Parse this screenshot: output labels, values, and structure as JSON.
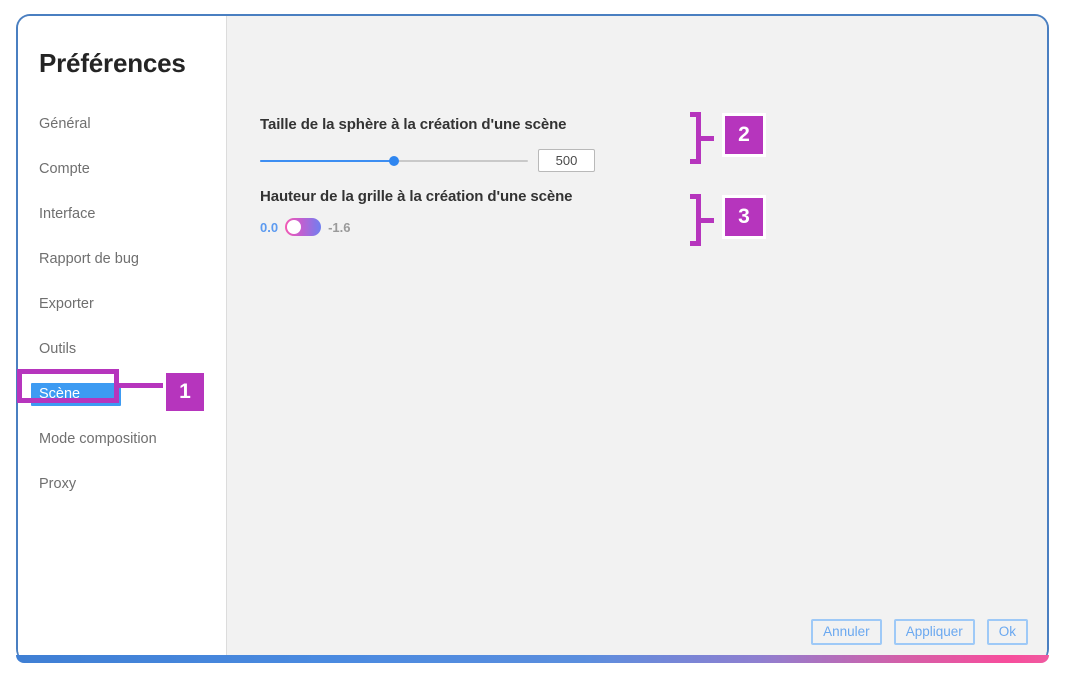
{
  "window": {
    "title": "Préférences",
    "border_color": "#4a7fc1",
    "bottom_gradient_from": "#3f7fd4",
    "bottom_gradient_to": "#f74d9c"
  },
  "sidebar": {
    "items": [
      {
        "label": "Général",
        "selected": false
      },
      {
        "label": "Compte",
        "selected": false
      },
      {
        "label": "Interface",
        "selected": false
      },
      {
        "label": "Rapport de bug",
        "selected": false
      },
      {
        "label": "Exporter",
        "selected": false
      },
      {
        "label": "Outils",
        "selected": false
      },
      {
        "label": "Scène",
        "selected": true
      },
      {
        "label": "Mode composition",
        "selected": false
      },
      {
        "label": "Proxy",
        "selected": false
      }
    ],
    "selected_bg": "#3d9bf2",
    "item_color": "#6f6f6f"
  },
  "settings": [
    {
      "label": "Taille de la sphère à la création d'une scène",
      "control": "slider",
      "value": "500",
      "slider_percent": 50,
      "track_color": "#c9c9c9",
      "fill_color": "#3d8ef2"
    },
    {
      "label": "Hauteur de la grille à la création d'une scène",
      "control": "toggle",
      "value_left": "0.0",
      "value_right": "-1.6",
      "toggle_on": false
    }
  ],
  "footer": {
    "cancel_label": "Annuler",
    "apply_label": "Appliquer",
    "ok_label": "Ok",
    "button_border": "#9ec9f7",
    "button_text": "#6aa8f0"
  },
  "annotations": {
    "color": "#b635bd",
    "markers": [
      {
        "number": "1",
        "target": "sidebar-item-scene"
      },
      {
        "number": "2",
        "target": "sphere-size-setting"
      },
      {
        "number": "3",
        "target": "grid-height-setting"
      }
    ]
  }
}
